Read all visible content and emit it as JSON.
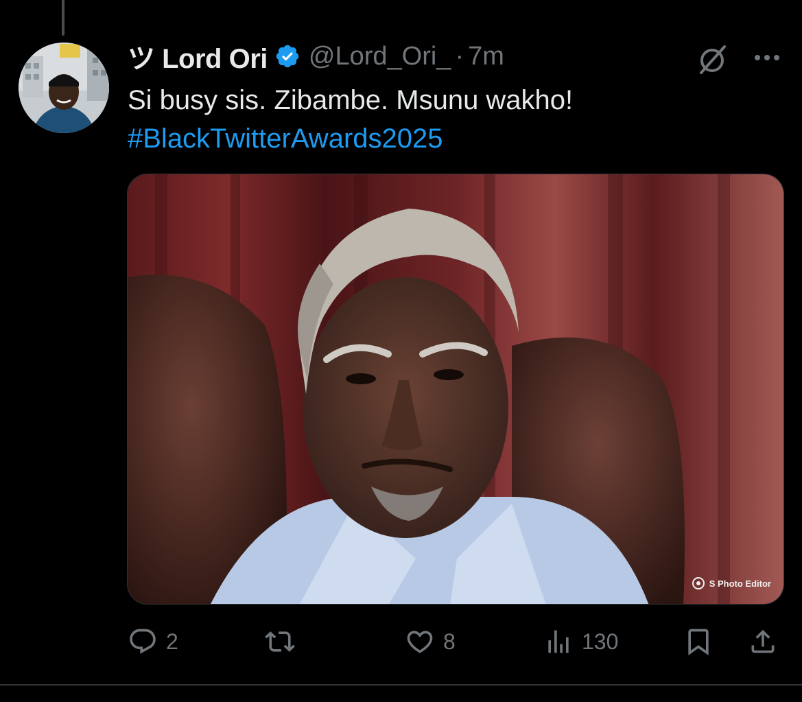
{
  "tweet": {
    "display_name": "ツ Lord Ori",
    "handle": "@Lord_Ori_",
    "separator": "·",
    "timestamp": "7m",
    "text_line1": "Si busy sis. Zibambe. Msunu wakho!",
    "hashtag": "#BlackTwitterAwards2025",
    "verified_color": "#1d9bf0"
  },
  "media": {
    "watermark": "S Photo Editor"
  },
  "actions": {
    "reply_count": "2",
    "retweet_count": "",
    "like_count": "8",
    "views_count": "130"
  },
  "icons": {
    "verified": "verified-badge-icon",
    "grok": "grok-icon",
    "more": "more-dots-icon",
    "reply": "reply-icon",
    "retweet": "retweet-icon",
    "like": "heart-icon",
    "views": "views-chart-icon",
    "bookmark": "bookmark-icon",
    "share": "share-icon"
  },
  "colors": {
    "background": "#000000",
    "text": "#e7e9ea",
    "muted": "#71767b",
    "link": "#1d9bf0"
  }
}
